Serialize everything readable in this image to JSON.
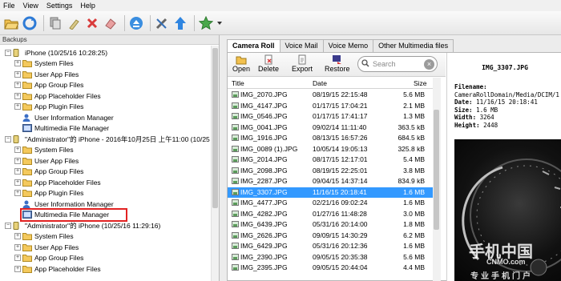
{
  "menu": [
    "File",
    "View",
    "Settings",
    "Help"
  ],
  "toolbar_icons": [
    "open-folder-icon",
    "refresh-icon",
    "copy-icon",
    "clean-icon",
    "delete-icon",
    "eraser-icon",
    "eject-icon",
    "tools-icon",
    "upload-icon",
    "star-icon"
  ],
  "backups_label": "Backups",
  "tree": [
    {
      "level": 0,
      "expander": "-",
      "icon": "device",
      "label": "iPhone (10/25/16 10:28:25)"
    },
    {
      "level": 1,
      "expander": "+",
      "icon": "folder",
      "label": "System Files"
    },
    {
      "level": 1,
      "expander": "+",
      "icon": "folder",
      "label": "User App Files"
    },
    {
      "level": 1,
      "expander": "+",
      "icon": "folder",
      "label": "App Group Files"
    },
    {
      "level": 1,
      "expander": "+",
      "icon": "folder",
      "label": "App Placeholder Files"
    },
    {
      "level": 1,
      "expander": "+",
      "icon": "folder",
      "label": "App Plugin Files"
    },
    {
      "level": 1,
      "expander": "",
      "icon": "user",
      "label": "User Information Manager"
    },
    {
      "level": 1,
      "expander": "",
      "icon": "media",
      "label": "Multimedia File Manager"
    },
    {
      "level": 0,
      "expander": "-",
      "icon": "device",
      "label": "\"Administrator\"的 iPhone - 2016年10月25日 上午11:00 (10/25"
    },
    {
      "level": 1,
      "expander": "+",
      "icon": "folder",
      "label": "System Files"
    },
    {
      "level": 1,
      "expander": "+",
      "icon": "folder",
      "label": "User App Files"
    },
    {
      "level": 1,
      "expander": "+",
      "icon": "folder",
      "label": "App Group Files"
    },
    {
      "level": 1,
      "expander": "+",
      "icon": "folder",
      "label": "App Placeholder Files"
    },
    {
      "level": 1,
      "expander": "+",
      "icon": "folder",
      "label": "App Plugin Files"
    },
    {
      "level": 1,
      "expander": "",
      "icon": "user",
      "label": "User Information Manager"
    },
    {
      "level": 1,
      "expander": "",
      "icon": "media",
      "label": "Multimedia File Manager",
      "highlighted": true
    },
    {
      "level": 0,
      "expander": "-",
      "icon": "device",
      "label": "\"Administrator\"的 iPhone (10/25/16 11:29:16)"
    },
    {
      "level": 1,
      "expander": "+",
      "icon": "folder",
      "label": "System Files"
    },
    {
      "level": 1,
      "expander": "+",
      "icon": "folder",
      "label": "User App Files"
    },
    {
      "level": 1,
      "expander": "+",
      "icon": "folder",
      "label": "App Group Files"
    },
    {
      "level": 1,
      "expander": "+",
      "icon": "folder",
      "label": "App Placeholder Files"
    }
  ],
  "tabs": [
    "Camera Roll",
    "Voice Mail",
    "Voice Memo",
    "Other Multimedia files"
  ],
  "actions": {
    "open": "Open",
    "delete": "Delete",
    "export": "Export",
    "restore": "Restore"
  },
  "search": {
    "placeholder": "Search"
  },
  "columns": {
    "title": "Title",
    "date": "Date",
    "size": "Size"
  },
  "files": [
    {
      "title": "IMG_2070.JPG",
      "date": "08/19/15 22:15:48",
      "size": "5.6 MB"
    },
    {
      "title": "IMG_4147.JPG",
      "date": "01/17/15 17:04:21",
      "size": "2.1 MB"
    },
    {
      "title": "IMG_0546.JPG",
      "date": "01/17/15 17:41:17",
      "size": "1.3 MB"
    },
    {
      "title": "IMG_0041.JPG",
      "date": "09/02/14 11:11:40",
      "size": "363.5 kB"
    },
    {
      "title": "IMG_1916.JPG",
      "date": "08/13/15 16:57:26",
      "size": "684.5 kB"
    },
    {
      "title": "IMG_0089 (1).JPG",
      "date": "10/05/14 19:05:13",
      "size": "325.8 kB"
    },
    {
      "title": "IMG_2014.JPG",
      "date": "08/17/15 12:17:01",
      "size": "5.4 MB"
    },
    {
      "title": "IMG_2098.JPG",
      "date": "08/19/15 22:25:01",
      "size": "3.8 MB"
    },
    {
      "title": "IMG_2287.JPG",
      "date": "09/04/15 14:37:14",
      "size": "834.9 kB"
    },
    {
      "title": "IMG_3307.JPG",
      "date": "11/16/15 20:18:41",
      "size": "1.6 MB",
      "selected": true
    },
    {
      "title": "IMG_4477.JPG",
      "date": "02/21/16 09:02:24",
      "size": "1.6 MB"
    },
    {
      "title": "IMG_4282.JPG",
      "date": "01/27/16 11:48:28",
      "size": "3.0 MB"
    },
    {
      "title": "IMG_6439.JPG",
      "date": "05/31/16 20:14:00",
      "size": "1.8 MB"
    },
    {
      "title": "IMG_2626.JPG",
      "date": "09/09/15 14:30:29",
      "size": "6.2 MB"
    },
    {
      "title": "IMG_6429.JPG",
      "date": "05/31/16 20:12:36",
      "size": "1.6 MB"
    },
    {
      "title": "IMG_2390.JPG",
      "date": "09/05/15 20:35:38",
      "size": "5.6 MB"
    },
    {
      "title": "IMG_2395.JPG",
      "date": "09/05/15 20:44:04",
      "size": "4.4 MB"
    }
  ],
  "preview": {
    "title": "IMG_3307.JPG",
    "filename_label": "Filename:",
    "filename": "CameraRollDomain/Media/DCIM/1",
    "date_label": "Date:",
    "date": "11/16/15 20:18:41",
    "size_label": "Size:",
    "size": "1.6 MB",
    "width_label": "Width:",
    "width": "3264",
    "height_label": "Height:",
    "height": "2448"
  },
  "watermark": {
    "brand_cn": "手机中国",
    "brand_en": "CNMO.com",
    "slogan": "专业手机门户"
  },
  "colors": {
    "selection": "#3399ff",
    "highlight_box": "#e22222"
  }
}
